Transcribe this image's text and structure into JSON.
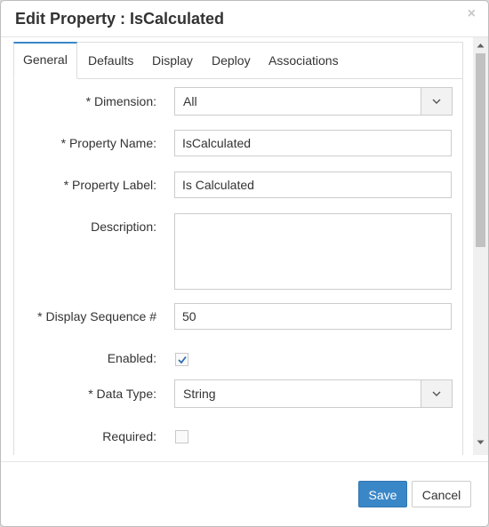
{
  "dialog": {
    "title": "Edit Property : IsCalculated",
    "close_glyph": "×"
  },
  "tabs": [
    {
      "label": "General",
      "active": true
    },
    {
      "label": "Defaults",
      "active": false
    },
    {
      "label": "Display",
      "active": false
    },
    {
      "label": "Deploy",
      "active": false
    },
    {
      "label": "Associations",
      "active": false
    }
  ],
  "form": {
    "dimension": {
      "label": "* Dimension:",
      "value": "All"
    },
    "property_name": {
      "label": "* Property Name:",
      "value": "IsCalculated"
    },
    "property_label": {
      "label": "* Property Label:",
      "value": "Is Calculated"
    },
    "description": {
      "label": "Description:",
      "value": ""
    },
    "display_sequence": {
      "label": "* Display Sequence #",
      "value": "50"
    },
    "enabled": {
      "label": "Enabled:",
      "checked": true
    },
    "data_type": {
      "label": "* Data Type:",
      "value": "String"
    },
    "required": {
      "label": "Required:",
      "checked": false
    }
  },
  "footer": {
    "save_label": "Save",
    "cancel_label": "Cancel"
  },
  "colors": {
    "accent": "#3a87c8",
    "check": "#2f6db5"
  },
  "icons": {
    "close": "close-icon",
    "dropdown": "chevron-down-icon",
    "check": "check-icon",
    "scroll_up": "scroll-up-arrow-icon",
    "scroll_down": "scroll-down-arrow-icon"
  }
}
